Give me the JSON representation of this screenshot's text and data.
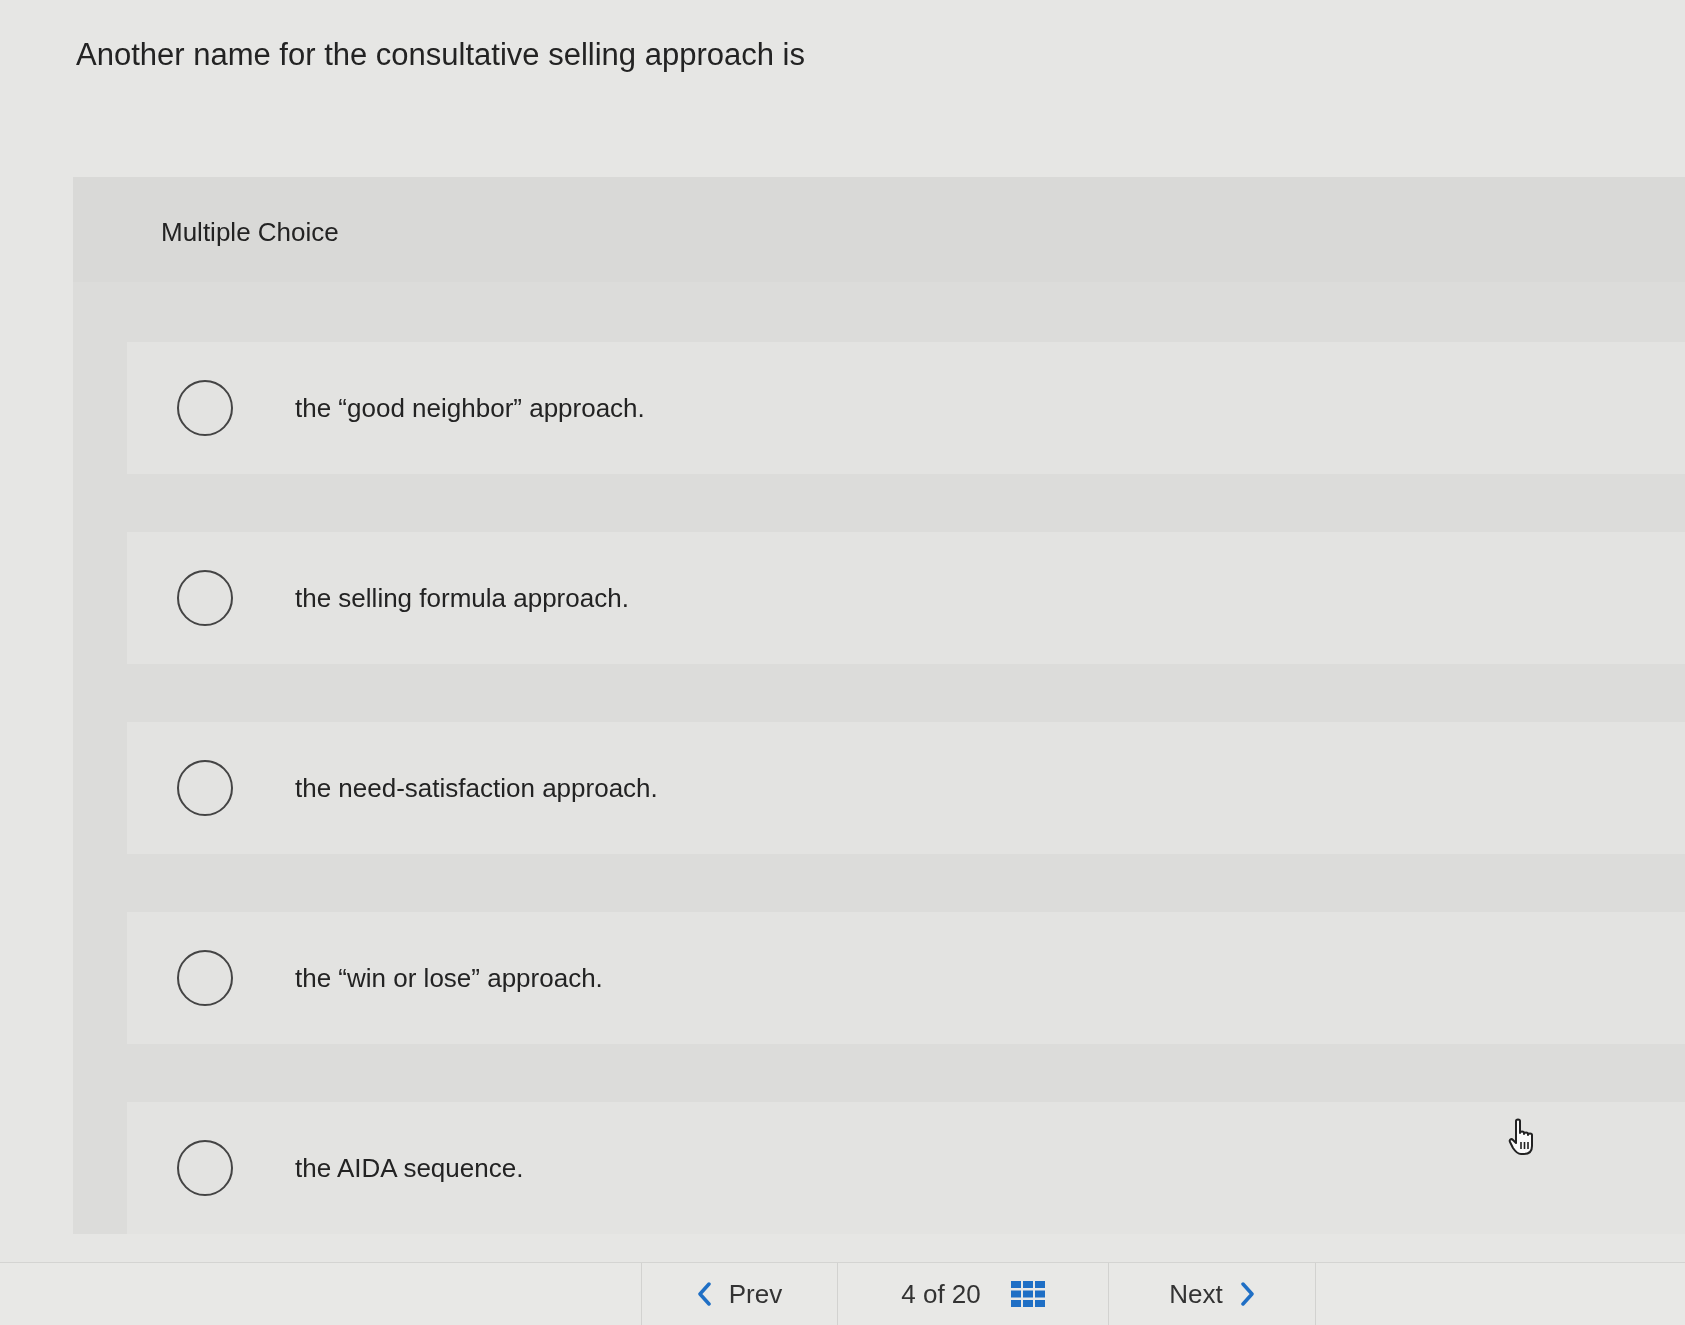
{
  "question": {
    "text": "Another name for the consultative selling approach is"
  },
  "answer_panel": {
    "heading": "Multiple Choice",
    "options": [
      {
        "label": "the “good neighbor” approach.",
        "selected": false
      },
      {
        "label": "the selling formula approach.",
        "selected": false
      },
      {
        "label": "the need-satisfaction approach.",
        "selected": false
      },
      {
        "label": "the “win or lose” approach.",
        "selected": false
      },
      {
        "label": "the AIDA sequence.",
        "selected": false
      }
    ]
  },
  "navigation": {
    "prev": "Prev",
    "position": "4 of 20",
    "next": "Next"
  }
}
